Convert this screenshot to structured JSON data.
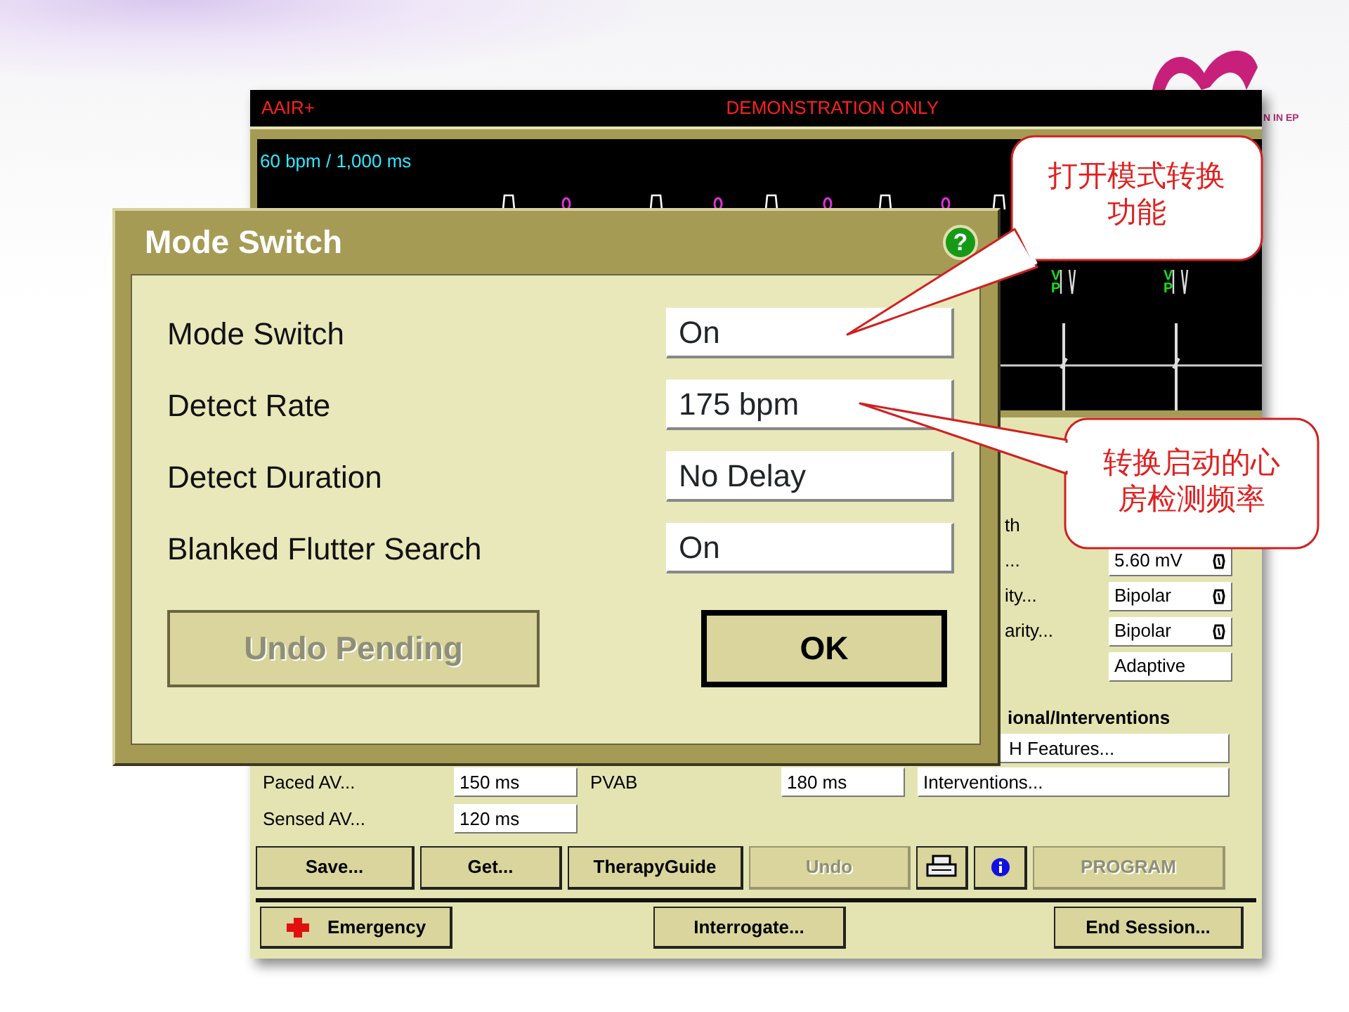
{
  "slide_logo": {
    "text": "N IN EP"
  },
  "programmer": {
    "mode": "AAIR+",
    "banner": "DEMONSTRATION ONLY",
    "ecg": {
      "rate": "60 bpm / 1,000 ms",
      "markers": [
        "VP",
        "VP"
      ]
    },
    "parameters": [
      {
        "label": "th"
      },
      {
        "label": "...",
        "value": "5.60 mV",
        "lockable": true
      },
      {
        "label": "ity...",
        "value": "Bipolar",
        "lockable": true
      },
      {
        "label": "arity...",
        "value": "Bipolar",
        "lockable": true
      },
      {
        "value": "Adaptive",
        "lockable": false
      }
    ],
    "section_title": "ional/Interventions",
    "links": [
      "H Features...",
      "Interventions..."
    ],
    "av_fields": [
      {
        "label": "Paced AV...",
        "value": "150 ms"
      },
      {
        "label": "PVAB",
        "value": "180 ms"
      },
      {
        "label": "Sensed AV...",
        "value": "120 ms"
      }
    ],
    "buttons": [
      {
        "kind": "text",
        "label": "Save...",
        "disabled": false
      },
      {
        "kind": "text",
        "label": "Get...",
        "disabled": false
      },
      {
        "kind": "text",
        "label": "TherapyGuide",
        "disabled": false
      },
      {
        "kind": "text",
        "label": "Undo",
        "disabled": true
      },
      {
        "kind": "printer",
        "disabled": false
      },
      {
        "kind": "info",
        "disabled": false
      },
      {
        "kind": "text",
        "label": "PROGRAM",
        "disabled": true
      }
    ],
    "footer_buttons": [
      {
        "kind": "emergency",
        "label": "Emergency"
      },
      {
        "kind": "text",
        "label": "Interrogate..."
      },
      {
        "kind": "text",
        "label": "End Session..."
      }
    ]
  },
  "dialog": {
    "title": "Mode Switch",
    "help": "?",
    "settings": [
      {
        "label": "Mode Switch",
        "value": "On"
      },
      {
        "label": "Detect Rate",
        "value": "175 bpm"
      },
      {
        "label": "Detect Duration",
        "value": "No Delay"
      },
      {
        "label": "Blanked Flutter Search",
        "value": "On"
      }
    ],
    "buttons": [
      {
        "label": "Undo Pending",
        "disabled": true,
        "default": false
      },
      {
        "label": "OK",
        "disabled": false,
        "default": true
      }
    ]
  },
  "callouts": [
    {
      "text": "打开模式转换功能"
    },
    {
      "text": "转换启动的心房检测频率"
    }
  ]
}
